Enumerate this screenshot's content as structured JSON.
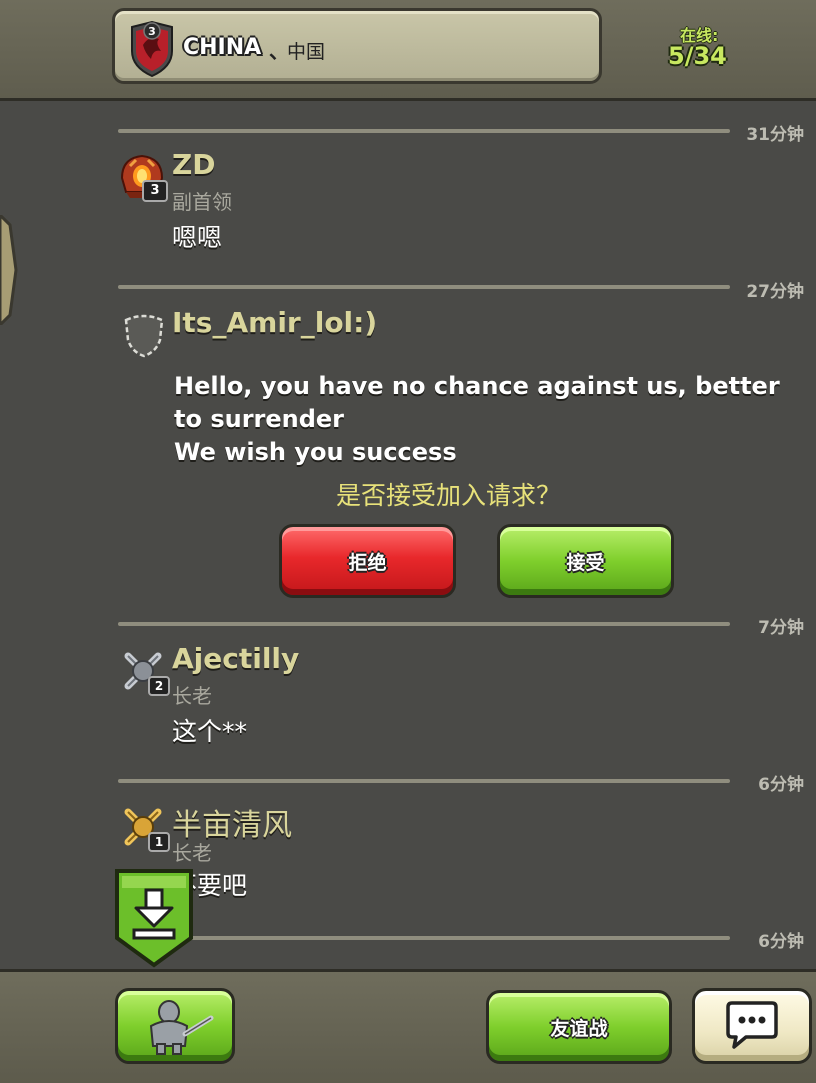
{
  "header": {
    "clan_name": "CHINA",
    "clan_separator": "、",
    "clan_tag": "中国",
    "clan_level": "3",
    "online_label": "在线:",
    "online_count": "5/34"
  },
  "messages": [
    {
      "timestamp": "31分钟",
      "username": "ZD",
      "role": "副首领",
      "text": "嗯嗯",
      "badge_level": "3",
      "avatar_icon": "red-helmet-icon"
    },
    {
      "timestamp": "27分钟",
      "username": "Its_Amir_lol:)",
      "text_lines": [
        "Hello, you have no chance against us, better",
        "to surrender",
        "We wish you success"
      ],
      "avatar_icon": "empty-shield-icon",
      "prompt": "是否接受加入请求？",
      "reject_label": "拒绝",
      "accept_label": "接受"
    },
    {
      "timestamp": "7分钟",
      "username": "Ajectilly",
      "role": "长老",
      "text": "这个**",
      "badge_level": "2",
      "avatar_icon": "crossed-swords-silver-icon"
    },
    {
      "timestamp": "6分钟",
      "username": "半亩清风",
      "role": "长老",
      "text": "不要吧",
      "badge_level": "1",
      "avatar_icon": "crossed-swords-gold-icon"
    },
    {
      "timestamp": "6分钟"
    }
  ],
  "footer": {
    "friendly_battle_label": "友谊战",
    "attack_icon": "barbarian-attack-icon",
    "chat_icon": "chat-bubble-icon"
  },
  "colors": {
    "background": "#4a4a47",
    "username": "#d9d59c",
    "prompt": "#e8e27a",
    "accept_green": "#7fcf2c",
    "reject_red": "#e8282b"
  }
}
